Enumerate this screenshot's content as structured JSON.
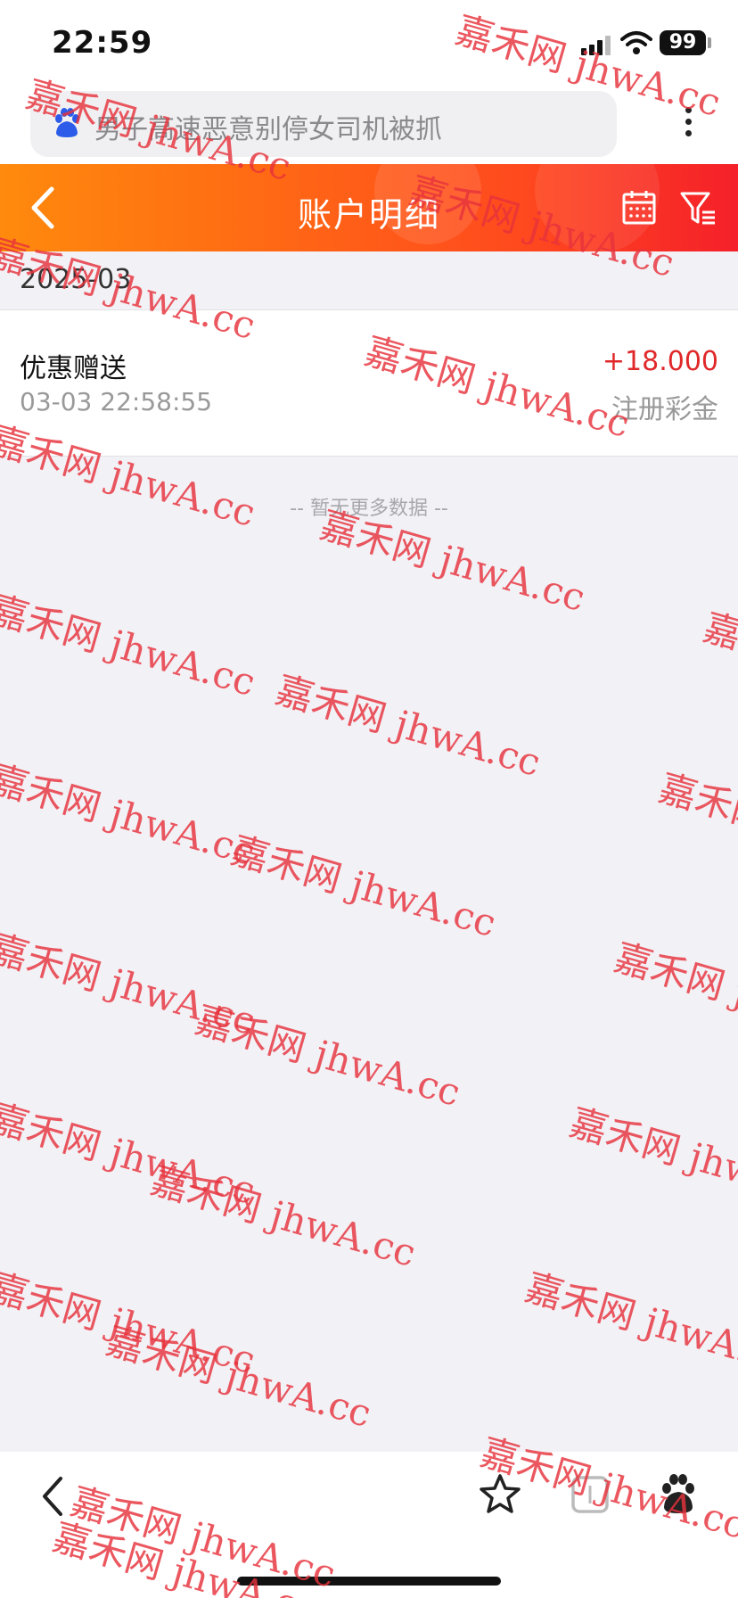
{
  "status_bar": {
    "time": "22:59",
    "battery": "99"
  },
  "browser": {
    "search_text": "男子高速恶意别停女司机被抓"
  },
  "header": {
    "title": "账户明细"
  },
  "month": {
    "label": "2025-03"
  },
  "records": [
    {
      "title": "优惠赠送",
      "time": "03-03 22:58:55",
      "amount": "+18.000",
      "type": "注册彩金"
    }
  ],
  "no_more": "-- 暂无更多数据 --",
  "watermark": "嘉禾网 jhwA.cc",
  "colors": {
    "header_start": "#ff8a0d",
    "header_end": "#f5202a",
    "amount": "#e0282a",
    "watermark": "#e6323c"
  }
}
